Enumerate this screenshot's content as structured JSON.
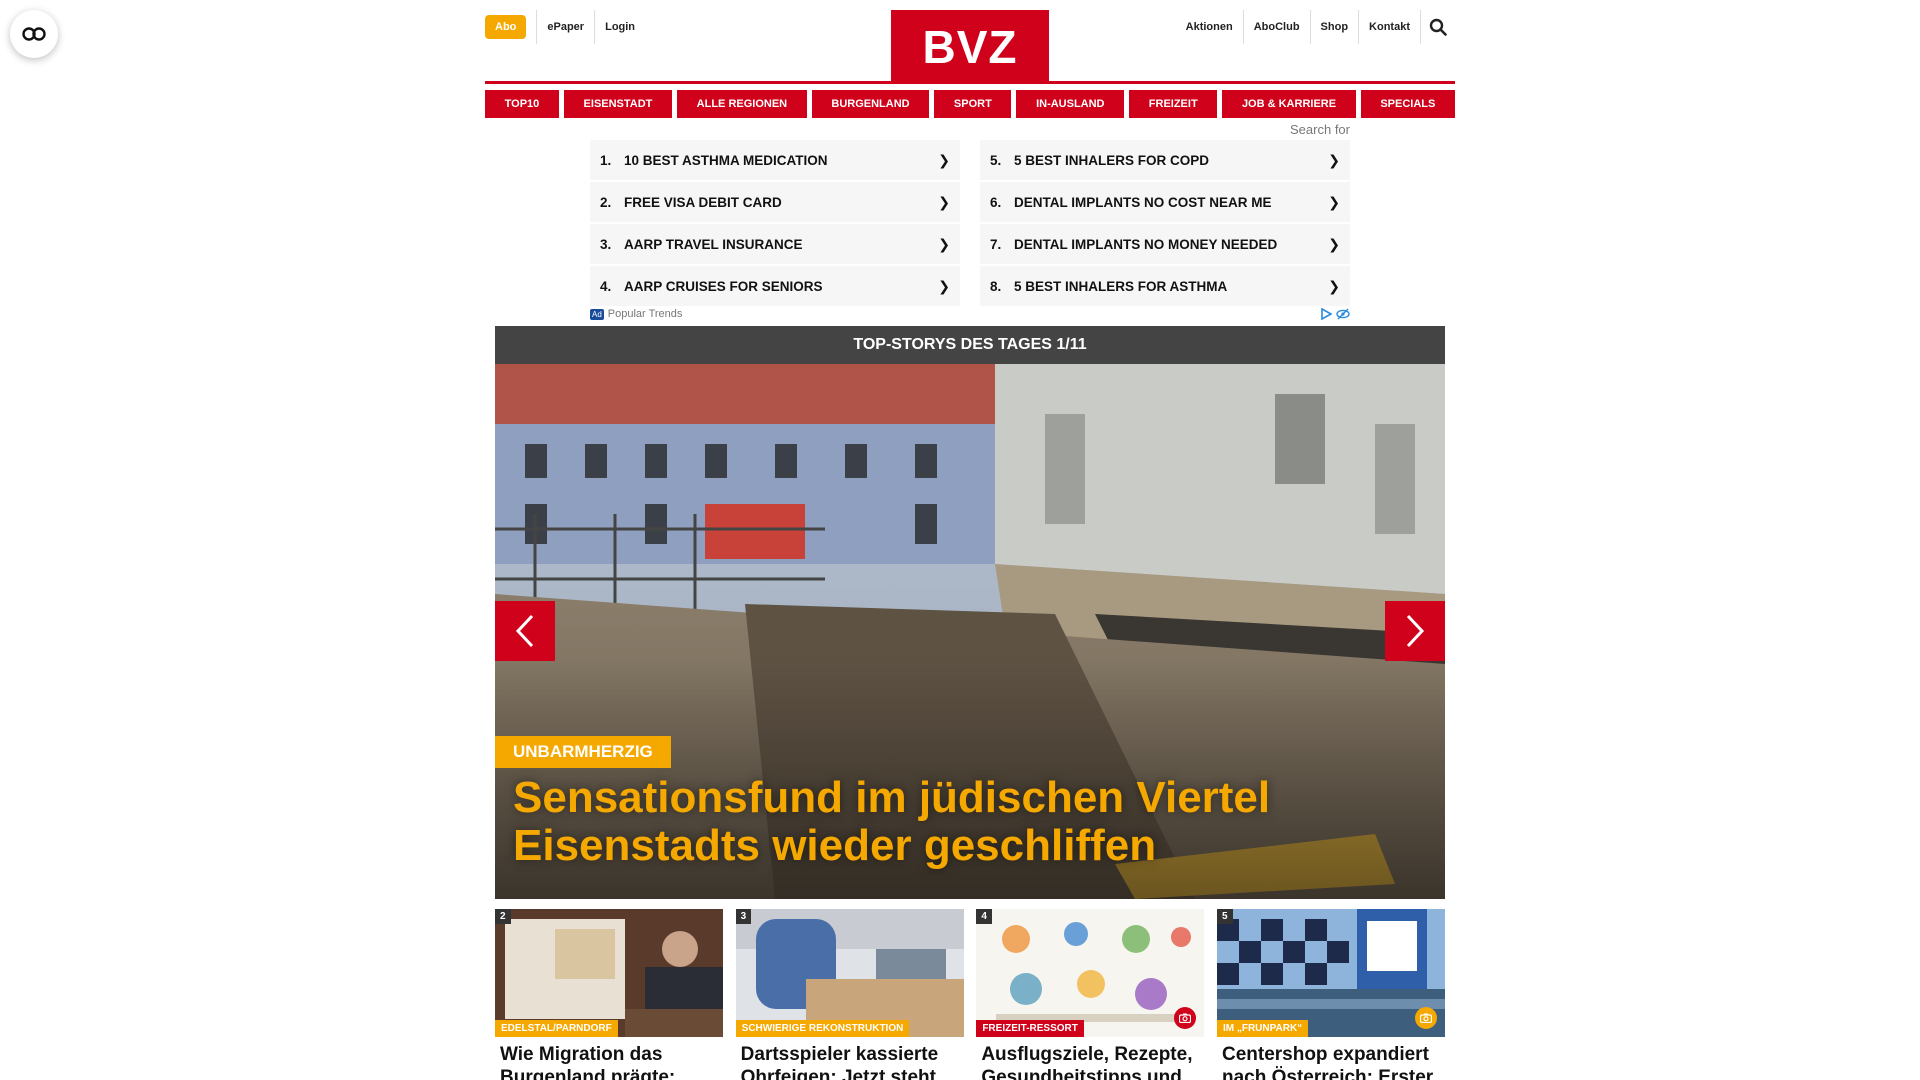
{
  "header": {
    "abo": "Abo",
    "epaper": "ePaper",
    "login": "Login",
    "logo": "BVZ",
    "right_links": [
      "Aktionen",
      "AboClub",
      "Shop",
      "Kontakt"
    ]
  },
  "nav": [
    "TOP10",
    "EISENSTADT",
    "ALLE REGIONEN",
    "BURGENLAND",
    "SPORT",
    "IN-AUSLAND",
    "FREIZEIT",
    "JOB & KARRIERE",
    "SPECIALS"
  ],
  "ads": {
    "search_for": "Search for",
    "items": [
      {
        "num": "1.",
        "text": "10 Best Asthma Medication"
      },
      {
        "num": "5.",
        "text": "5 Best Inhalers for COPD"
      },
      {
        "num": "2.",
        "text": "Free Visa Debit Card"
      },
      {
        "num": "6.",
        "text": "Dental Implants No Cost Near Me"
      },
      {
        "num": "3.",
        "text": "AARP Travel Insurance"
      },
      {
        "num": "7.",
        "text": "Dental Implants No Money Needed"
      },
      {
        "num": "4.",
        "text": "AARP Cruises for Seniors"
      },
      {
        "num": "8.",
        "text": "5 Best Inhalers for Asthma"
      }
    ],
    "badge": "Ad",
    "source": "Popular Trends",
    "arrow_glyph": "❯"
  },
  "top_stories": {
    "heading": "TOP-STORYS DES TAGES 1/11",
    "hero": {
      "kicker": "UNBARMHERZIG",
      "title": "Sensationsfund im jüdischen Viertel Eisenstadts wieder geschliffen"
    },
    "thumbs": [
      {
        "num": "2",
        "kicker": "EDELSTAL/PARNDORF",
        "kicker_color": "#f5a800",
        "title": "Wie Migration das Burgenland prägte:",
        "camera": false
      },
      {
        "num": "3",
        "kicker": "SCHWIERIGE REKONSTRUKTION",
        "kicker_color": "#f5a800",
        "title": "Dartsspieler kassierte Ohrfeigen: Jetzt steht er",
        "camera": false
      },
      {
        "num": "4",
        "kicker": "FREIZEIT-RESSORT",
        "kicker_color": "#d0021b",
        "title": "Ausflugsziele, Rezepte, Gesundheitstipps und",
        "camera": true,
        "camera_color": "#d0021b"
      },
      {
        "num": "5",
        "kicker": "IM „FRUNPARK“",
        "kicker_color": "#f5a800",
        "title": "Centershop expandiert nach Österreich: Erster",
        "camera": true,
        "camera_color": "#f5a800"
      }
    ]
  },
  "colors": {
    "brand_red": "#d0021b",
    "accent_orange": "#f5a800",
    "header_gray": "#444444"
  },
  "icons": [
    "reader-mode-icon",
    "search-icon",
    "chevron-left-icon",
    "chevron-right-icon",
    "camera-icon",
    "adchoices-icon"
  ]
}
